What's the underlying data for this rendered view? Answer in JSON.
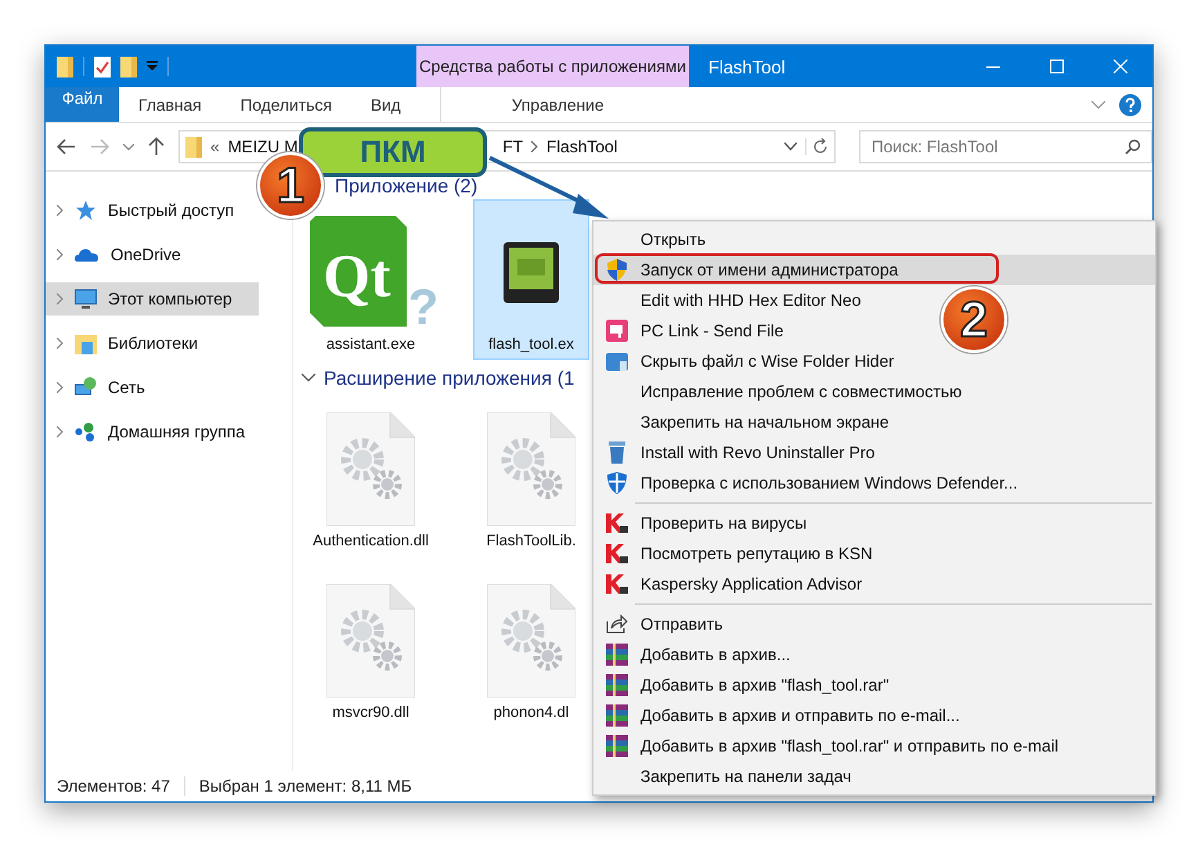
{
  "window": {
    "contextual_tab": "Средства работы с приложениями",
    "title": "FlashTool"
  },
  "ribbon_tabs": [
    {
      "label": "Файл",
      "kind": "file",
      "selected": false
    },
    {
      "label": "Главная",
      "kind": "tab",
      "selected": false
    },
    {
      "label": "Поделиться",
      "kind": "tab",
      "selected": false
    },
    {
      "label": "Вид",
      "kind": "tab",
      "selected": false
    },
    {
      "label": "Управление",
      "kind": "contextual",
      "selected": false
    }
  ],
  "address_bar": {
    "crumbs": [
      {
        "label": "«",
        "kind": "overflow"
      },
      {
        "label": "MEIZU M",
        "kind": "crumb"
      },
      {
        "label": "FT",
        "kind": "crumb"
      },
      {
        "label": "FlashTool",
        "kind": "crumb"
      }
    ]
  },
  "search": {
    "placeholder": "Поиск: FlashTool"
  },
  "sidebar": {
    "items": [
      {
        "label": "Быстрый доступ",
        "kind": "star",
        "selected": false
      },
      {
        "label": "OneDrive",
        "kind": "cloud",
        "selected": false
      },
      {
        "label": "Этот компьютер",
        "kind": "computer",
        "selected": true
      },
      {
        "label": "Библиотеки",
        "kind": "library",
        "selected": false
      },
      {
        "label": "Сеть",
        "kind": "network",
        "selected": false
      },
      {
        "label": "Домашняя группа",
        "kind": "homegroup",
        "selected": false
      }
    ]
  },
  "groups": [
    {
      "title": "Приложение (2)",
      "files": [
        {
          "name": "assistant.exe",
          "kind": "qt",
          "logo_text": "Qt",
          "logo_mark": "?",
          "selected": false
        },
        {
          "name": "flash_tool.ex",
          "kind": "android",
          "selected": true
        }
      ]
    },
    {
      "title": "Расширение приложения (1",
      "files": [
        {
          "name": "Authentication.dll",
          "kind": "dll",
          "selected": false
        },
        {
          "name": "FlashToolLib.",
          "kind": "dll",
          "selected": false
        },
        {
          "name": "msvcr90.dll",
          "kind": "dll",
          "selected": false
        },
        {
          "name": "phonon4.dl",
          "kind": "dll",
          "selected": false
        }
      ]
    }
  ],
  "context_menu": {
    "items": [
      {
        "label": "Открыть",
        "kind": "plain",
        "selected": false
      },
      {
        "label": "Запуск от имени администратора",
        "kind": "admin",
        "selected": true
      },
      {
        "label": "Edit with HHD Hex Editor Neo",
        "kind": "plain",
        "selected": false
      },
      {
        "label": "PC Link - Send File",
        "kind": "pclink",
        "selected": false
      },
      {
        "label": "Скрыть файл с Wise Folder Hider",
        "kind": "hider",
        "selected": false
      },
      {
        "label": "Исправление проблем с совместимостью",
        "kind": "plain",
        "selected": false
      },
      {
        "label": "Закрепить на начальном экране",
        "kind": "plain",
        "selected": false
      },
      {
        "label": "Install with Revo Uninstaller Pro",
        "kind": "revo",
        "selected": false
      },
      {
        "label": "Проверка с использованием Windows Defender...",
        "kind": "defender",
        "selected": false
      },
      {
        "kind": "separator"
      },
      {
        "label": "Проверить на вирусы",
        "kind": "kaspersky",
        "selected": false
      },
      {
        "label": "Посмотреть репутацию в KSN",
        "kind": "kaspersky",
        "selected": false
      },
      {
        "label": "Kaspersky Application Advisor",
        "kind": "kaspersky",
        "selected": false
      },
      {
        "kind": "separator"
      },
      {
        "label": "Отправить",
        "kind": "send",
        "selected": false
      },
      {
        "label": "Добавить в архив...",
        "kind": "archive",
        "selected": false
      },
      {
        "label": "Добавить в архив \"flash_tool.rar\"",
        "kind": "archive",
        "selected": false
      },
      {
        "label": "Добавить в архив и отправить по e-mail...",
        "kind": "archive",
        "selected": false
      },
      {
        "label": "Добавить в архив \"flash_tool.rar\" и отправить по e-mail",
        "kind": "archive",
        "selected": false
      },
      {
        "label": "Закрепить на панели задач",
        "kind": "plain",
        "selected": false
      }
    ]
  },
  "status_bar": {
    "count": "Элементов: 47",
    "selection": "Выбран 1 элемент: 8,11 МБ"
  },
  "annotations": {
    "callout": "ПКМ",
    "step_1": "1",
    "step_2": "2"
  }
}
